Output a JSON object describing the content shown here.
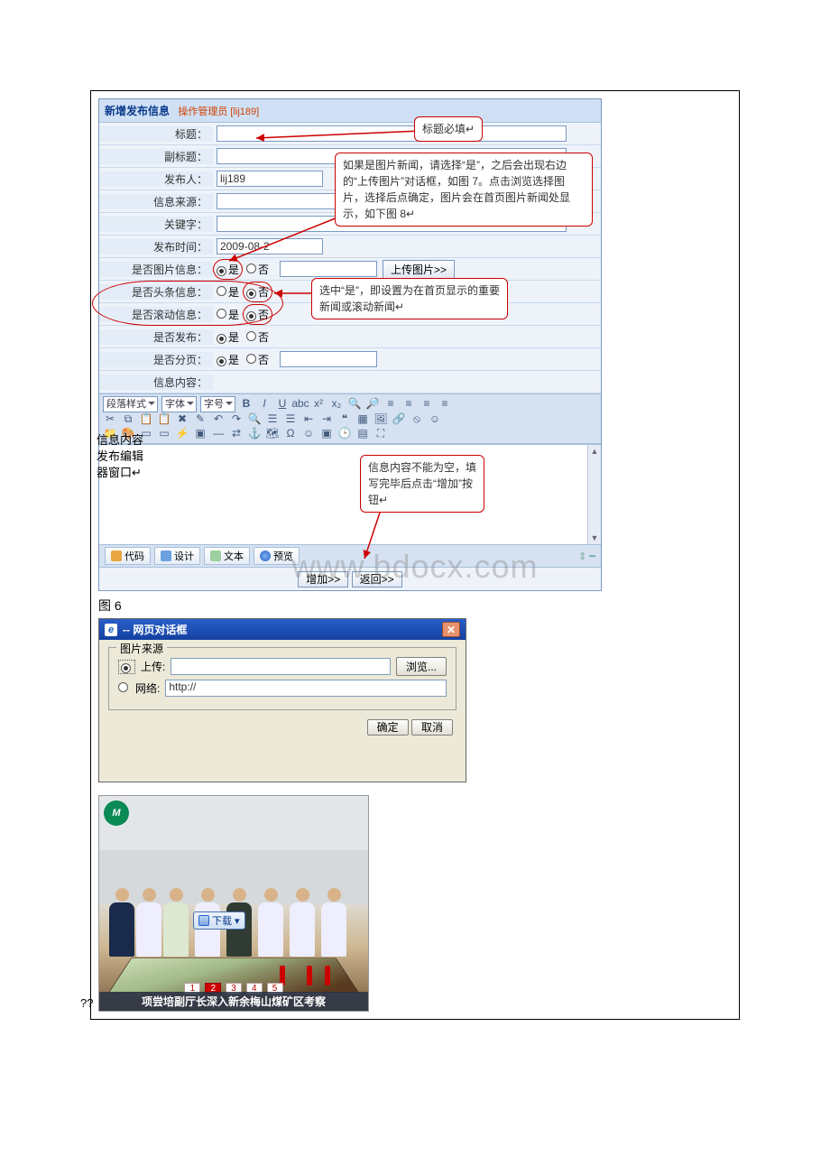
{
  "form": {
    "title": "新增发布信息",
    "operator_prefix": "操作管理员",
    "operator_id": "[lij189]",
    "labels": {
      "title": "标题：",
      "subtitle": "副标题：",
      "publisher": "发布人：",
      "source": "信息来源：",
      "keyword": "关键字：",
      "pubtime": "发布时间：",
      "is_image": "是否图片信息：",
      "is_headline": "是否头条信息：",
      "is_scroll": "是否滚动信息：",
      "is_publish": "是否发布：",
      "is_paged": "是否分页：",
      "content": "信息内容："
    },
    "values": {
      "publisher": "lij189",
      "pubtime": "2009-08-2"
    },
    "radio": {
      "yes": "是",
      "no": "否"
    },
    "upload_btn": "上传图片>>",
    "toolbar": {
      "para": "段落样式",
      "font": "字体",
      "size": "字号"
    },
    "tabs": {
      "code": "代码",
      "design": "设计",
      "text": "文本",
      "preview": "预览"
    },
    "submit": "增加>>",
    "back": "返回>>"
  },
  "callouts": {
    "title_required": "标题必填↵",
    "image_help": "如果是图片新闻，请选择“是”，之后会出现右边的“上传图片”对话框，如图 7。点击浏览选择图片，选择后点确定，图片会在首页图片新闻处显示，如下图 8↵",
    "headline_help": "选中“是”，即设置为在首页显示的重要新闻或滚动新闻↵",
    "side_note": "信息内容\n发布编辑\n器窗口↵",
    "content_help": "信息内容不能为空，填写完毕后点击“增加”按钮↵"
  },
  "caption": "图 6",
  "watermark": "www.bdocx.com",
  "dialog": {
    "title": "-- 网页对话框",
    "legend": "图片来源",
    "upload_label": "上传:",
    "net_label": "网络:",
    "net_value": "http://",
    "browse": "浏览...",
    "ok": "确定",
    "cancel": "取消"
  },
  "photo": {
    "download": "下载",
    "pager": [
      "1",
      "2",
      "3",
      "4",
      "5"
    ],
    "caption": "项尝培副厅长深入新余梅山煤矿区考察"
  },
  "qq": "??"
}
